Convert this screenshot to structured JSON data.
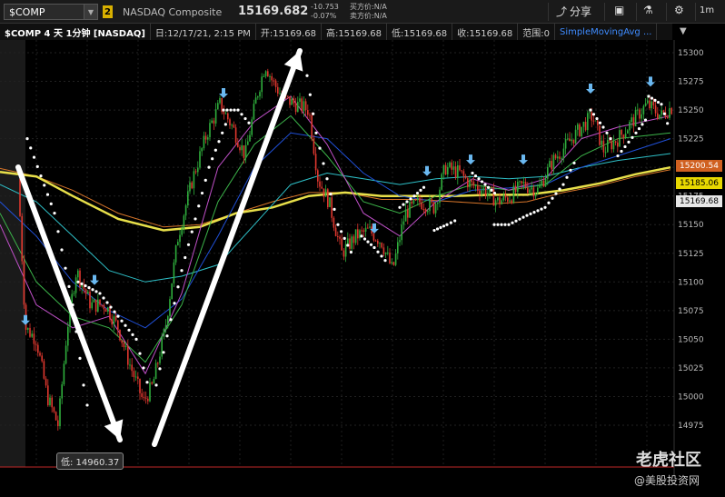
{
  "toolbar": {
    "symbol": "$COMP",
    "badge": "2",
    "description": "NASDAQ Composite",
    "last_price": "15169.682",
    "change": "-10.753",
    "change_pct": "-0.07%",
    "bid": "买方价:N/A",
    "ask": "卖方价:N/A",
    "share_label": "分享",
    "timeframe": "1m"
  },
  "study_header": {
    "title": "$COMP 4 天 1分钟 [NASDAQ]",
    "date": "日:12/17/21, 2:15 PM",
    "open": "开:15169.68",
    "high": "高:15169.68",
    "low": "低:15169.68",
    "close": "收:15169.68",
    "range": "范围:0",
    "sma": "SimpleMovingAvg ..."
  },
  "axis": {
    "ticks": [
      "15300",
      "15275",
      "15250",
      "15225",
      "15200",
      "15175",
      "15150",
      "15125",
      "15100",
      "15075",
      "15050",
      "15025",
      "15000",
      "14975"
    ]
  },
  "price_tags": {
    "tag1": "15200.54",
    "tag2": "15185.06",
    "tag3": "15169.68"
  },
  "low_marker": "低: 14960.37",
  "watermark": {
    "line1": "老虎社区",
    "line2": "@美股投资网"
  },
  "colors": {
    "up": "#2fae3c",
    "down": "#e0382f",
    "ma_yellow": "#e8e04a",
    "ma_orange": "#d8762a",
    "ma_teal": "#2ec0c8",
    "ma_blue": "#2050d8",
    "ma_green": "#3cb44a",
    "ma_magenta": "#c050c8"
  }
}
